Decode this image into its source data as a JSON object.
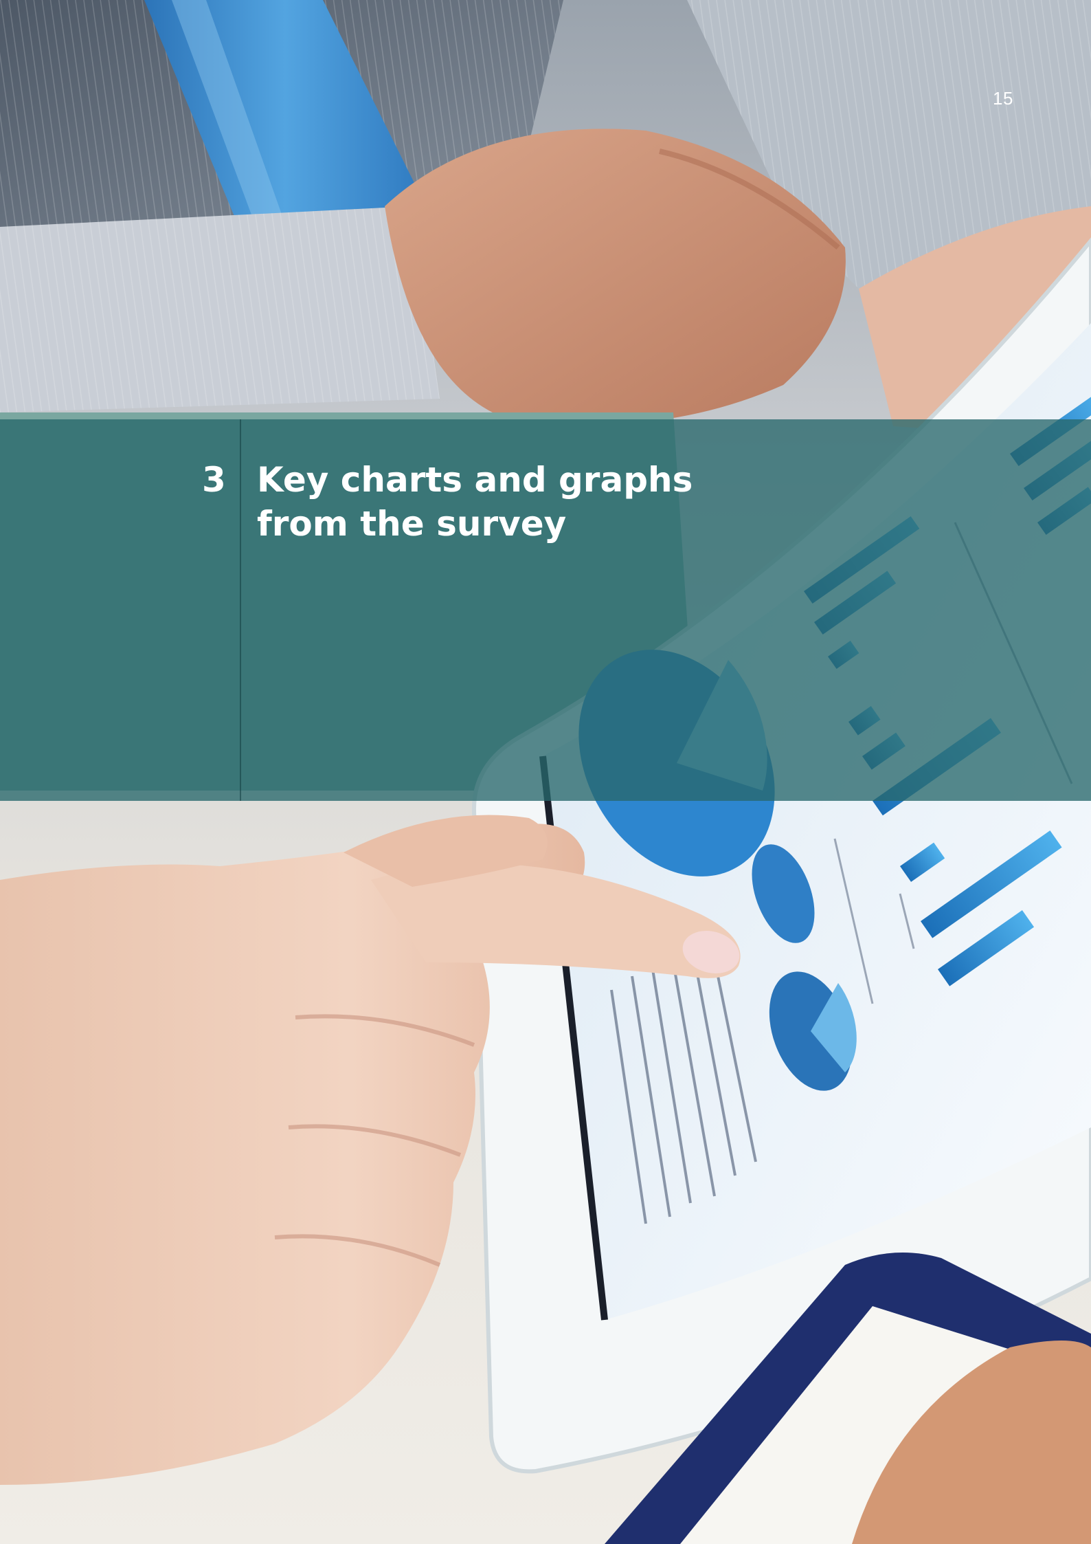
{
  "page": {
    "number": "15"
  },
  "section": {
    "number": "3",
    "title_lines": [
      "Key charts and graphs",
      "from the survey"
    ]
  },
  "colors": {
    "banner": "#28686c",
    "text": "#ffffff",
    "tablet_accent": "#1f7fc4",
    "clipboard": "#1f2f6e"
  },
  "photo": {
    "subject": "business people reviewing charts on a tablet"
  }
}
